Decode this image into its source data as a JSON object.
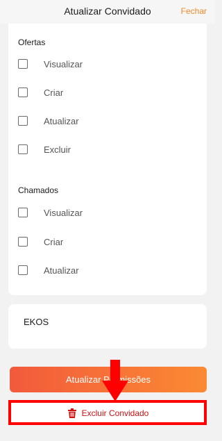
{
  "header": {
    "title": "Atualizar Convidado",
    "close_label": "Fechar"
  },
  "sections": [
    {
      "title": "Ofertas",
      "items": [
        {
          "label": "Visualizar",
          "checked": false
        },
        {
          "label": "Criar",
          "checked": false
        },
        {
          "label": "Atualizar",
          "checked": false
        },
        {
          "label": "Excluir",
          "checked": false
        }
      ]
    },
    {
      "title": "Chamados",
      "items": [
        {
          "label": "Visualizar",
          "checked": false
        },
        {
          "label": "Criar",
          "checked": false
        },
        {
          "label": "Atualizar",
          "checked": false
        }
      ]
    }
  ],
  "ekos": {
    "label": "EKOS"
  },
  "actions": {
    "update_label": "Atualizar Permissões",
    "delete_label": "Excluir Convidado",
    "delete_icon": "trash-icon"
  },
  "colors": {
    "accent": "#f08a2a",
    "gradient_start": "#f25a3c",
    "gradient_end": "#fb8a33",
    "danger": "#cc1111",
    "annotation": "#ff0000"
  }
}
